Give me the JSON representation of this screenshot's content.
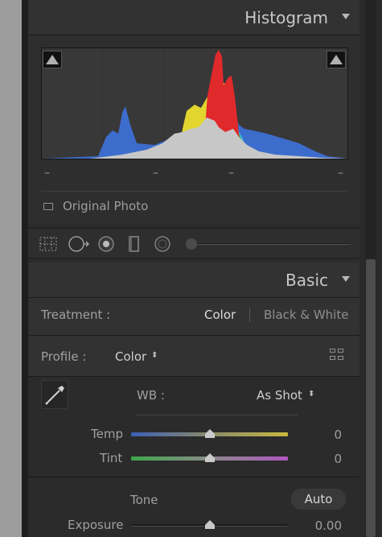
{
  "histogram": {
    "title": "Histogram",
    "shadow_clip_dash": "–",
    "dash_1": "–",
    "dash_2": "–",
    "highlight_clip_dash": "–",
    "original_photo_label": "Original Photo"
  },
  "tools": [
    "crop-overlay",
    "spot-removal",
    "red-eye",
    "graduated-filter",
    "radial-filter",
    "adjustment-brush"
  ],
  "basic": {
    "title": "Basic",
    "treatment_label": "Treatment :",
    "treatment_color": "Color",
    "treatment_bw": "Black & White",
    "profile_label": "Profile :",
    "profile_value": "Color",
    "profile_arrows": "⬍",
    "wb_label": "WB :",
    "wb_value": "As Shot",
    "wb_arrows": "⬍",
    "temp_label": "Temp",
    "temp_value": "0",
    "tint_label": "Tint",
    "tint_value": "0",
    "tone_label": "Tone",
    "auto_label": "Auto",
    "exposure_label": "Exposure",
    "exposure_value": "0.00"
  },
  "colors": {
    "panel_bg": "#2b2b2b",
    "header_bg": "#323232",
    "text": "#a0a0a0",
    "active_text": "#dcdcdc"
  }
}
